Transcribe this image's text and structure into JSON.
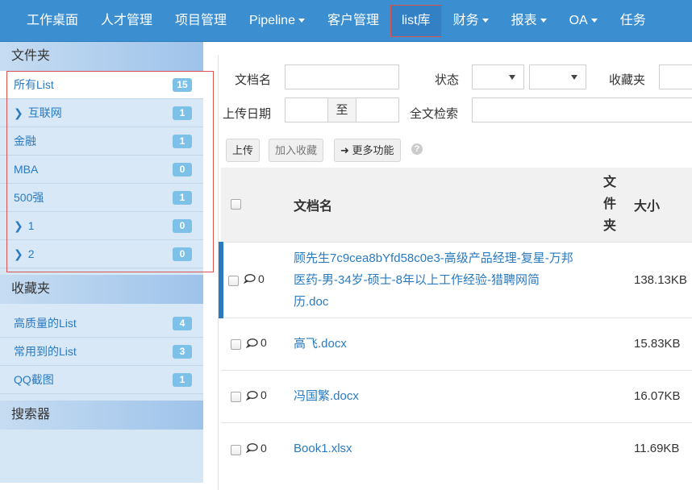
{
  "nav": [
    {
      "label": "工作桌面",
      "caret": false
    },
    {
      "label": "人才管理",
      "caret": false
    },
    {
      "label": "项目管理",
      "caret": false
    },
    {
      "label": "Pipeline",
      "caret": true
    },
    {
      "label": "客户管理",
      "caret": false
    },
    {
      "label": "list库",
      "caret": false,
      "active": true
    },
    {
      "label": "财务",
      "caret": true
    },
    {
      "label": "报表",
      "caret": true
    },
    {
      "label": "OA",
      "caret": true
    },
    {
      "label": "任务",
      "caret": false
    }
  ],
  "sidebar": {
    "folders_title": "文件夹",
    "folders": [
      {
        "label": "所有List",
        "count": "15",
        "expandable": false,
        "selected": true
      },
      {
        "label": "互联网",
        "count": "1",
        "expandable": true
      },
      {
        "label": "金融",
        "count": "1",
        "expandable": false
      },
      {
        "label": "MBA",
        "count": "0",
        "expandable": false
      },
      {
        "label": "500强",
        "count": "1",
        "expandable": false
      },
      {
        "label": "1",
        "count": "0",
        "expandable": true
      },
      {
        "label": "2",
        "count": "0",
        "expandable": true
      }
    ],
    "favorites_title": "收藏夹",
    "favorites": [
      {
        "label": "高质量的List",
        "count": "4"
      },
      {
        "label": "常用到的List",
        "count": "3"
      },
      {
        "label": "QQ截图",
        "count": "1"
      }
    ],
    "search_title": "搜索器"
  },
  "filters": {
    "docname_label": "文档名",
    "status_label": "状态",
    "favorites_label": "收藏夹",
    "upload_date_label": "上传日期",
    "to_label": "至",
    "fulltext_label": "全文检索"
  },
  "toolbar": {
    "upload": "上传",
    "add_favorite": "加入收藏",
    "more": "更多功能",
    "help": "?"
  },
  "table": {
    "col_name": "文档名",
    "col_folder": [
      "文",
      "件",
      "夹"
    ],
    "col_size": "大小",
    "rows": [
      {
        "comments": "0",
        "name_lines": [
          "顾先生7c9cea8bYfd58c0e3-高级产品经理-复星-万邦",
          "医药-男-34岁-硕士-8年以上工作经验-猎聘网简",
          "历.doc"
        ],
        "size": "138.13KB"
      },
      {
        "comments": "0",
        "name_lines": [
          "高飞.docx"
        ],
        "size": "15.83KB"
      },
      {
        "comments": "0",
        "name_lines": [
          "冯国繁.docx"
        ],
        "size": "16.07KB"
      },
      {
        "comments": "0",
        "name_lines": [
          "Book1.xlsx"
        ],
        "size": "11.69KB"
      }
    ]
  }
}
